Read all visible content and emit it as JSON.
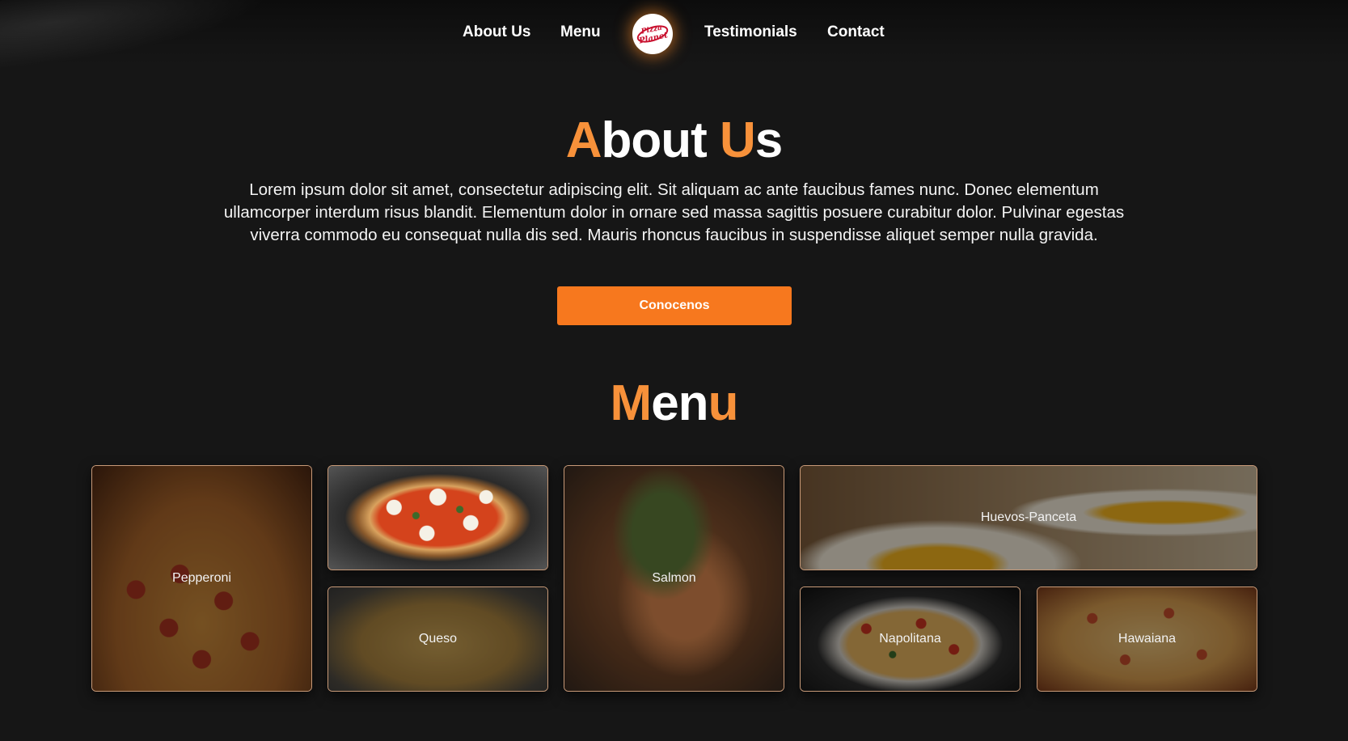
{
  "nav": {
    "links": [
      "About Us",
      "Menu",
      "Testimonials",
      "Contact"
    ],
    "logo_text_top": "Pizza",
    "logo_text_bottom": "Planet"
  },
  "about": {
    "title_accent_1": "A",
    "title_rest_1": "bout ",
    "title_accent_2": "U",
    "title_rest_2": "s",
    "body": "Lorem ipsum dolor sit amet, consectetur adipiscing elit. Sit aliquam ac ante faucibus fames nunc. Donec elementum ullamcorper interdum risus blandit. Elementum dolor in ornare sed massa sagittis posuere curabitur dolor. Pulvinar egestas viverra commodo eu consequat nulla dis sed. Mauris rhoncus faucibus in suspendisse aliquet semper nulla gravida.",
    "button": "Conocenos"
  },
  "menu": {
    "title_accent_1": "M",
    "title_rest": "en",
    "title_accent_2": "u",
    "items": [
      "Pepperoni",
      "",
      "Queso",
      "Salmon",
      "Huevos-Panceta",
      "Napolitana",
      "Hawaiana"
    ]
  },
  "colors": {
    "accent": "#f7913a",
    "button": "#f7781e",
    "background": "#161616",
    "card_border": "#c89a78"
  }
}
